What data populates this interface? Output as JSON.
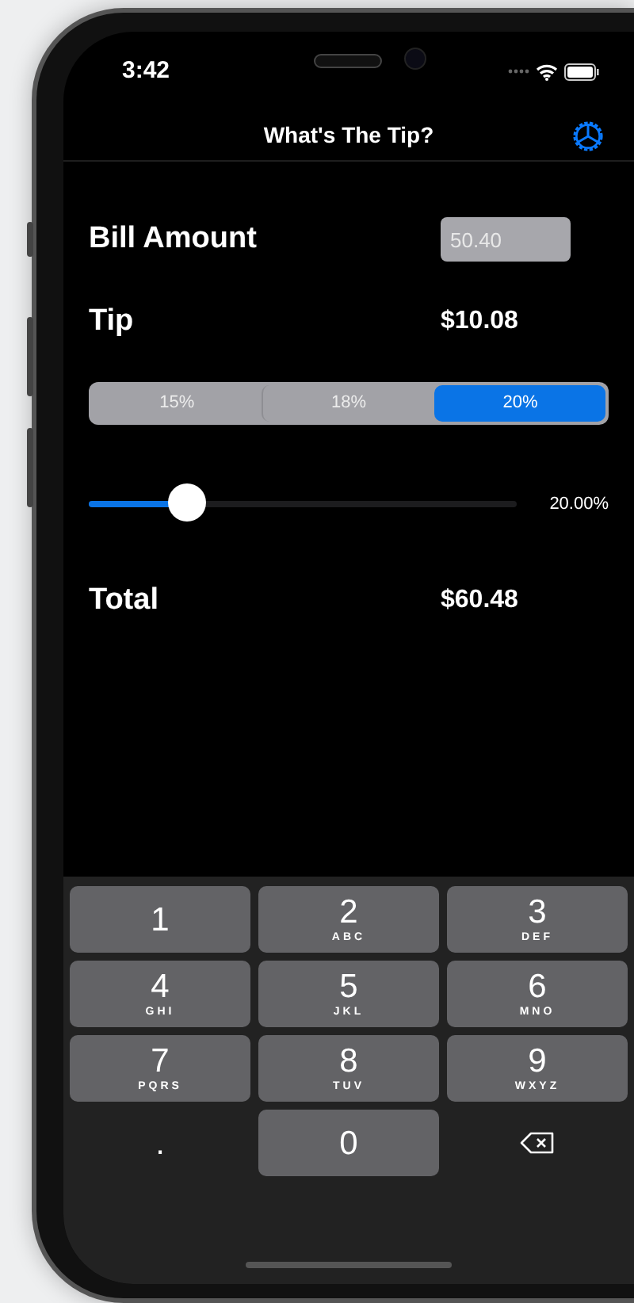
{
  "status_bar": {
    "time": "3:42"
  },
  "nav": {
    "title": "What's The Tip?"
  },
  "bill": {
    "label": "Bill Amount",
    "value": "50.40"
  },
  "tip": {
    "label": "Tip",
    "amount": "$10.08"
  },
  "tip_options": [
    {
      "label": "15%",
      "selected": false
    },
    {
      "label": "18%",
      "selected": false
    },
    {
      "label": "20%",
      "selected": true
    }
  ],
  "slider": {
    "level": 0.23,
    "reading": "20.00%"
  },
  "total": {
    "label": "Total",
    "amount": "$60.48"
  },
  "keypad": [
    {
      "kind": "key",
      "digit": "1"
    },
    {
      "kind": "key",
      "digit": "2",
      "letters": "ABC"
    },
    {
      "kind": "key",
      "digit": "3",
      "letters": "DEF"
    },
    {
      "kind": "key",
      "digit": "4",
      "letters": "GHI"
    },
    {
      "kind": "key",
      "digit": "5",
      "letters": "JKL"
    },
    {
      "kind": "key",
      "digit": "6",
      "letters": "MNO"
    },
    {
      "kind": "key",
      "digit": "7",
      "letters": "PQRS"
    },
    {
      "kind": "key",
      "digit": "8",
      "letters": "TUV"
    },
    {
      "kind": "key",
      "digit": "9",
      "letters": "WXYZ"
    },
    {
      "kind": "plain",
      "digit": "."
    },
    {
      "kind": "key",
      "digit": "0"
    },
    {
      "kind": "delete"
    }
  ]
}
